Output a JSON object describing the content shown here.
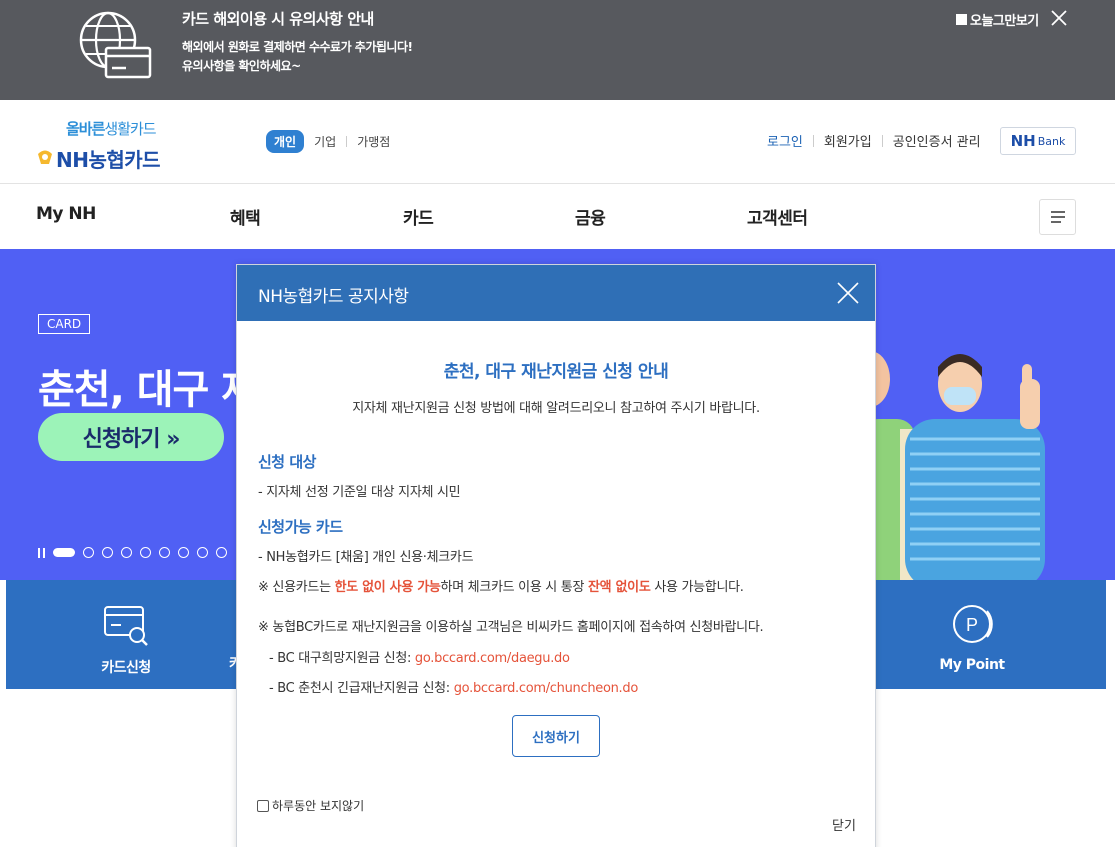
{
  "topbar": {
    "title": "카드 해외이용 시 유의사항 안내",
    "line1": "해외에서 원화로 결제하면 수수료가 추가됩니다!",
    "line2": "유의사항을 확인하세요~",
    "today_label": "오늘그만보기"
  },
  "header": {
    "logo_slogan_bold": "올바른",
    "logo_slogan": "생활카드",
    "logo_brand": "NH농협카드",
    "segments": [
      "개인",
      "기업",
      "가맹점"
    ],
    "util": [
      "로그인",
      "회원가입",
      "공인인증서 관리"
    ],
    "nhbank_bold": "NH",
    "nhbank_text": "Bank"
  },
  "gnb": [
    "My NH",
    "혜택",
    "카드",
    "금융",
    "고객센터"
  ],
  "hero": {
    "tag": "CARD",
    "headline": "춘천, 대구 재",
    "button": "신청하기 »"
  },
  "quick": {
    "items": [
      {
        "label": "카드신청",
        "icon": "card-search-icon"
      },
      {
        "label": "카",
        "icon": "card-icon"
      },
      {
        "label": "My Point",
        "icon": "point-icon"
      }
    ]
  },
  "modal": {
    "header_title": "NH농협카드 공지사항",
    "title": "춘천, 대구 재난지원금 신청 안내",
    "subtitle": "지자체 재난지원금 신청 방법에 대해 알려드리오니 참고하여 주시기 바랍니다.",
    "sec1_title": "신청 대상",
    "sec1_item": "-  지자체 선정 기준일 대상 지자체 시민",
    "sec2_title": "신청가능 카드",
    "sec2_item": "-  NH농협카드 [채움] 개인 신용·체크카드",
    "note1_a": "※ 신용카드는 ",
    "note1_b": "한도 없이 사용 가능",
    "note1_c": "하며 체크카드 이용 시 통장 ",
    "note1_d": "잔액 없이도",
    "note1_e": " 사용 가능합니다.",
    "note2": "※ 농협BC카드로 재난지원금을 이용하실 고객님은 비씨카드 홈페이지에 접속하여 신청바랍니다.",
    "bc1_label": "- BC 대구희망지원금 신청: ",
    "bc1_link": "go.bccard.com/daegu.do",
    "bc2_label": "- BC 춘천시 긴급재난지원금 신청: ",
    "bc2_link": "go.bccard.com/chuncheon.do",
    "apply_button": "신청하기",
    "no_show_label": "하루동안 보지않기",
    "close_label": "닫기"
  },
  "colors": {
    "topbar_bg": "#57595e",
    "brand_blue": "#2d6fc1",
    "hero_bg": "#5060f4",
    "hero_button": "#9cf3b8",
    "highlight_red": "#e5533a"
  }
}
